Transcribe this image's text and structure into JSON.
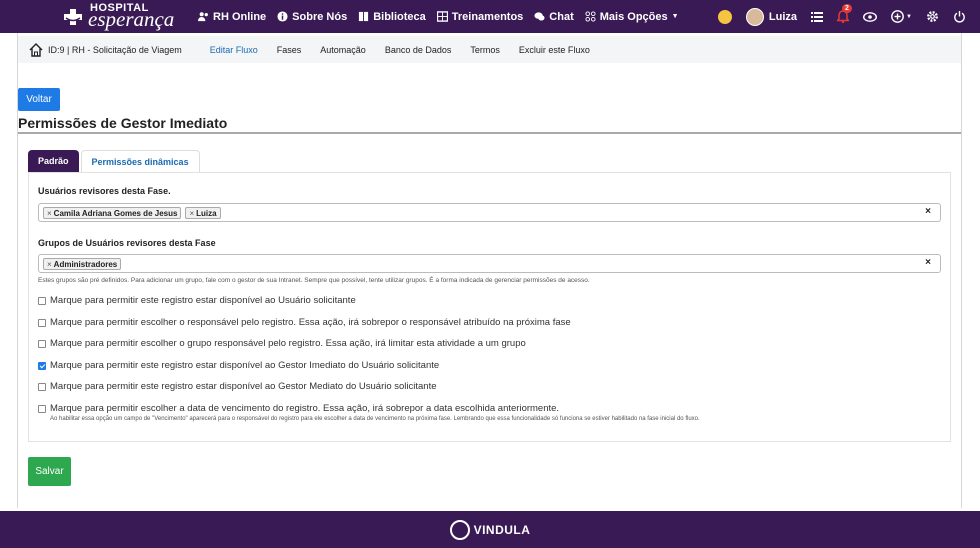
{
  "brand": {
    "small": "HOSPITAL",
    "big": "esperança"
  },
  "nav": [
    {
      "label": "RH Online",
      "icon": "users-icon"
    },
    {
      "label": "Sobre Nós",
      "icon": "info-icon"
    },
    {
      "label": "Biblioteca",
      "icon": "book-icon"
    },
    {
      "label": "Treinamentos",
      "icon": "grid-icon"
    },
    {
      "label": "Chat",
      "icon": "chat-icon"
    },
    {
      "label": "Mais Opções",
      "icon": "apps-icon"
    }
  ],
  "user": {
    "name": "Luiza",
    "notifications": "2"
  },
  "subnav": {
    "title": "ID:9 | RH - Solicitação de Viagem",
    "links": [
      "Editar Fluxo",
      "Fases",
      "Automação",
      "Banco de Dados",
      "Termos",
      "Excluir este Fluxo"
    ]
  },
  "buttons": {
    "back": "Voltar",
    "save": "Salvar"
  },
  "page_title": "Permissões de Gestor Imediato",
  "tabs": [
    "Padrão",
    "Permissões dinâmicas"
  ],
  "form": {
    "users_label": "Usuários revisores desta Fase.",
    "users_chips": [
      "Camila Adriana Gomes de Jesus",
      "Luiza"
    ],
    "groups_label": "Grupos de Usuários revisores desta Fase",
    "groups_chips": [
      "Administradores"
    ],
    "clear": "×",
    "chip_remove": "×",
    "groups_help": "Estes grupos são pré definidos. Para adicionar um grupo, fale com o gestor de sua Intranet. Sempre que possível, tente utilizar grupos. É a forma indicada de gerenciar permissões de acesso.",
    "checkboxes": [
      {
        "label": "Marque para permitir este registro estar disponível ao Usuário solicitante",
        "checked": false
      },
      {
        "label": "Marque para permitir escolher o responsável pelo registro. Essa ação, irá sobrepor o responsável atribuído na próxima fase",
        "checked": false
      },
      {
        "label": "Marque para permitir escolher o grupo responsável pelo registro. Essa ação, irá limitar esta atividade a um grupo",
        "checked": false
      },
      {
        "label": "Marque para permitir este registro estar disponível ao Gestor Imediato do Usuário solicitante",
        "checked": true
      },
      {
        "label": "Marque para permitir este registro estar disponível ao Gestor Mediato do Usuário solicitante",
        "checked": false
      },
      {
        "label": "Marque para permitir escolher a data de vencimento do registro. Essa ação, irá sobrepor a data escolhida anteriormente.",
        "checked": false
      }
    ],
    "due_date_note": "Ao habilitar essa opção um campo de \"Vencimento\" aparecerá para o responsável do registro para ele escolher a data de vencimento na próxima fase. Lembrando que essa funcionalidade só funciona se estiver habilitado na fase inicial do fluxo."
  },
  "footer": {
    "brand": "VINDULA"
  },
  "colors": {
    "header": "#3a1a55",
    "primary": "#1e7be6",
    "success": "#2ea84f",
    "link": "#1a6ab0"
  }
}
